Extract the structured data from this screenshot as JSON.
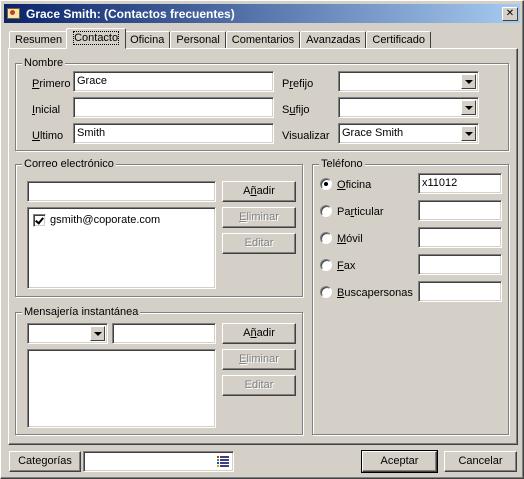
{
  "window": {
    "title": "Grace Smith: (Contactos frecuentes)",
    "close_label": "✕"
  },
  "tabs": [
    {
      "label": "Resumen"
    },
    {
      "label": "Contacto"
    },
    {
      "label": "Oficina"
    },
    {
      "label": "Personal"
    },
    {
      "label": "Comentarios"
    },
    {
      "label": "Avanzadas"
    },
    {
      "label": "Certificado"
    }
  ],
  "active_tab": "Contacto",
  "nombre": {
    "legend": "Nombre",
    "primero": {
      "label_key": "P",
      "label_rest": "rimero",
      "value": "Grace"
    },
    "inicial": {
      "label_key": "I",
      "label_rest": "nicial",
      "value": ""
    },
    "ultimo": {
      "label_key": "U",
      "label_rest": "ltimo",
      "value": "Smith"
    },
    "prefijo": {
      "label_pre": "P",
      "label_key": "r",
      "label_rest": "efijo",
      "value": ""
    },
    "sufijo": {
      "label_pre": "S",
      "label_key": "u",
      "label_rest": "fijo",
      "value": ""
    },
    "visualizar": {
      "label": "Visualizar",
      "value": "Grace Smith"
    }
  },
  "correo": {
    "legend": "Correo electrónico",
    "input_value": "",
    "add_pre": "A",
    "add_key": "ñ",
    "add_rest": "adir",
    "remove_key": "E",
    "remove_rest": "liminar",
    "edit_label": "Editar",
    "items": [
      {
        "address": "gsmith@coporate.com",
        "checked": true
      }
    ]
  },
  "mensajeria": {
    "legend": "Mensajería instantánea",
    "service_value": "",
    "address_value": "",
    "add_pre": "A",
    "add_key": "ñ",
    "add_rest": "adir",
    "remove_key": "E",
    "remove_rest": "liminar",
    "edit_label": "Editar"
  },
  "telefono": {
    "legend": "Teléfono",
    "oficina": {
      "label_key": "O",
      "label_rest": "ficina",
      "value": "x11012",
      "checked": true
    },
    "particular": {
      "label_pre": "Pa",
      "label_key": "r",
      "label_rest": "ticular",
      "value": "",
      "checked": false
    },
    "movil": {
      "label_key": "M",
      "label_rest": "óvil",
      "value": "",
      "checked": false
    },
    "fax": {
      "label_key": "F",
      "label_rest": "ax",
      "value": "",
      "checked": false
    },
    "buscapersonas": {
      "label_key": "B",
      "label_rest": "uscapersonas",
      "value": "",
      "checked": false
    }
  },
  "footer": {
    "categorias_label": "Categorías",
    "categorias_value": "",
    "categorias_icon": "category-list-icon",
    "aceptar_label": "Aceptar",
    "cancelar_label": "Cancelar"
  }
}
